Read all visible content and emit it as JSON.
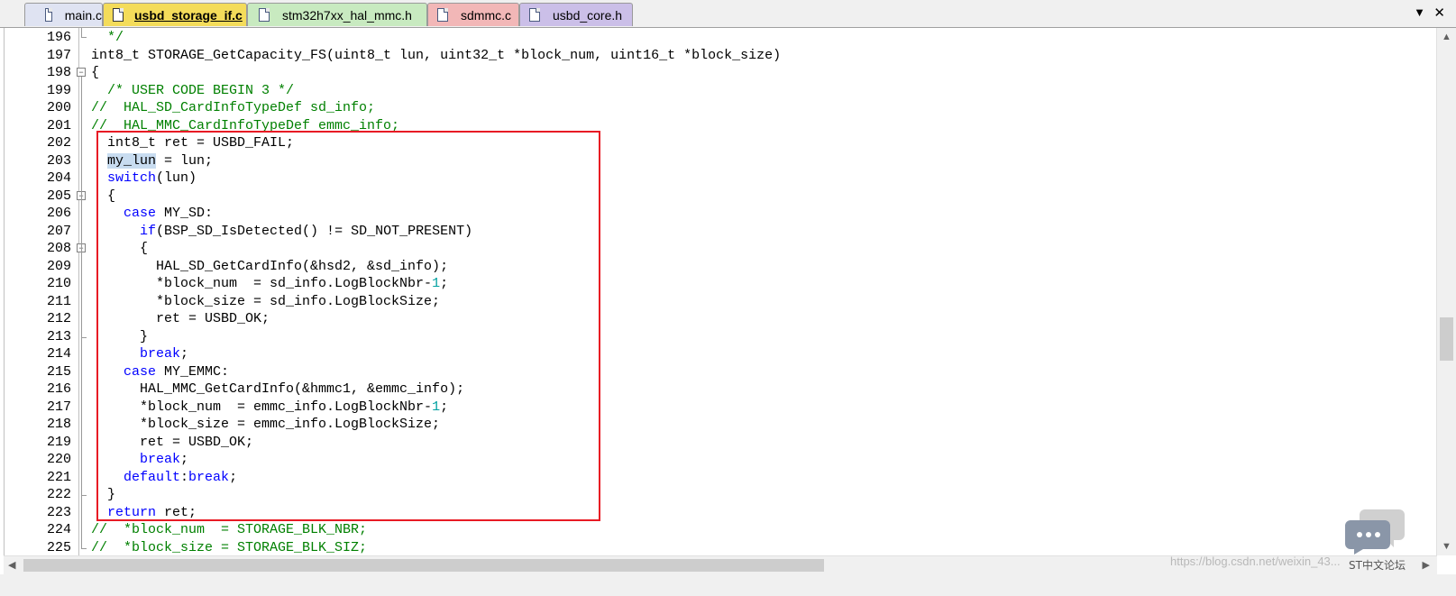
{
  "tabs": [
    {
      "label": "main.c",
      "color": "#dfe3f2",
      "active": false
    },
    {
      "label": "usbd_storage_if.c",
      "color": "#f4dc5a",
      "active": true
    },
    {
      "label": "stm32h7xx_hal_mmc.h",
      "color": "#c8eac0",
      "active": false
    },
    {
      "label": "sdmmc.c",
      "color": "#f2b7b7",
      "active": false
    },
    {
      "label": "usbd_core.h",
      "color": "#cbbfe8",
      "active": false
    }
  ],
  "tab_controls": {
    "dropdown": "▼",
    "close": "✕"
  },
  "editor": {
    "line_numbers": [
      "196",
      "197",
      "198",
      "199",
      "200",
      "201",
      "202",
      "203",
      "204",
      "205",
      "206",
      "207",
      "208",
      "209",
      "210",
      "211",
      "212",
      "213",
      "214",
      "215",
      "216",
      "217",
      "218",
      "219",
      "220",
      "221",
      "222",
      "223",
      "224",
      "225"
    ],
    "lines": [
      "  */",
      "int8_t STORAGE_GetCapacity_FS(uint8_t lun, uint32_t *block_num, uint16_t *block_size)",
      "{",
      "  /* USER CODE BEGIN 3 */",
      "//  HAL_SD_CardInfoTypeDef sd_info;",
      "//  HAL_MMC_CardInfoTypeDef emmc_info;",
      "  int8_t ret = USBD_FAIL;",
      "  my_lun = lun;",
      "  switch(lun)",
      "  {",
      "    case MY_SD:",
      "      if(BSP_SD_IsDetected() != SD_NOT_PRESENT)",
      "      {",
      "        HAL_SD_GetCardInfo(&hsd2, &sd_info);",
      "        *block_num  = sd_info.LogBlockNbr-1;",
      "        *block_size = sd_info.LogBlockSize;",
      "        ret = USBD_OK;",
      "      }",
      "      break;",
      "    case MY_EMMC:",
      "      HAL_MMC_GetCardInfo(&hmmc1, &emmc_info);",
      "      *block_num  = emmc_info.LogBlockNbr-1;",
      "      *block_size = emmc_info.LogBlockSize;",
      "      ret = USBD_OK;",
      "      break;",
      "    default:break;",
      "  }",
      "  return ret;",
      "//  *block_num  = STORAGE_BLK_NBR;",
      "//  *block_size = STORAGE_BLK_SIZ;"
    ]
  },
  "scrollbars": {
    "up": "▲",
    "down": "▼",
    "left": "◀",
    "right": "▶",
    "vertical_position": 0.56,
    "horizontal_visible_fraction": 0.57
  },
  "watermark": {
    "url_text": "https://blog.csdn.net/weixin_43...",
    "forum_text": "ST中文论坛"
  },
  "colors": {
    "keyword": "#0000ff",
    "comment": "#008000",
    "number": "#00a0a0",
    "highlight_box": "#e81a24"
  }
}
